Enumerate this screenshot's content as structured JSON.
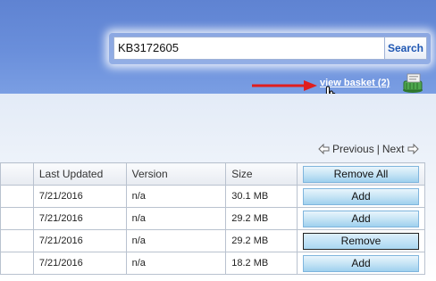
{
  "search": {
    "value": "KB3172605",
    "button_label": "Search"
  },
  "basket": {
    "link_label": "view basket (2)",
    "icon": "basket-icon"
  },
  "pager": {
    "previous_label": "Previous",
    "separator": "|",
    "next_label": "Next"
  },
  "table": {
    "headers": [
      "",
      "Last Updated",
      "Version",
      "Size",
      "Remove All"
    ],
    "rows": [
      {
        "last_updated": "7/21/2016",
        "version": "n/a",
        "size": "30.1 MB",
        "action": "Add"
      },
      {
        "last_updated": "7/21/2016",
        "version": "n/a",
        "size": "29.2 MB",
        "action": "Add"
      },
      {
        "last_updated": "7/21/2016",
        "version": "n/a",
        "size": "29.2 MB",
        "action": "Remove"
      },
      {
        "last_updated": "7/21/2016",
        "version": "n/a",
        "size": "18.2 MB",
        "action": "Add"
      }
    ]
  },
  "colors": {
    "header_blue": "#6a8fdb",
    "annotation_red": "#e01e1e",
    "search_text": "#1f57b3"
  }
}
